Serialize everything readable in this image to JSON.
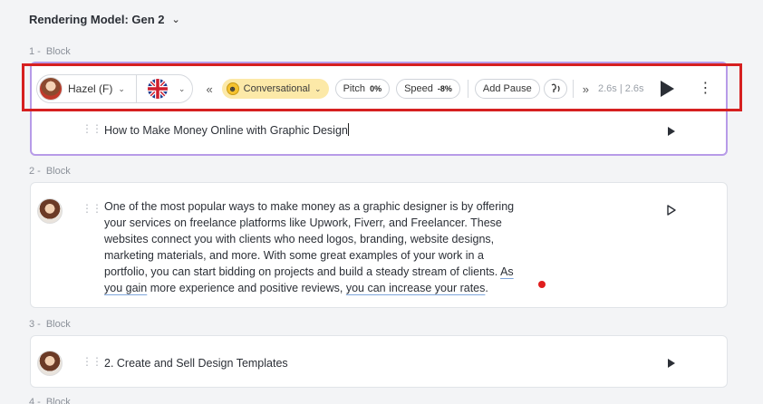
{
  "header": {
    "model_label": "Rendering Model: Gen 2"
  },
  "toolbar": {
    "voice_name": "Hazel (F)",
    "style_label": "Conversational",
    "pitch_label": "Pitch",
    "pitch_value": "0%",
    "speed_label": "Speed",
    "speed_value": "-8%",
    "add_pause_label": "Add Pause",
    "timing": "2.6s | 2.6s"
  },
  "blocks": [
    {
      "num": "1 -",
      "label": "Block",
      "text": "How to Make Money Online with Graphic Design"
    },
    {
      "num": "2 -",
      "label": "Block",
      "lines": [
        "One of the most popular ways to make money as a graphic designer is by offering",
        "your services on freelance platforms like Upwork, Fiverr, and Freelancer. These",
        "websites connect you with clients who need logos, branding, website designs,",
        "marketing materials, and more. With some great examples of your work in a",
        "portfolio, you can start bidding on projects and build a steady stream of clients.",
        "As",
        "you gain",
        " more experience and positive reviews, ",
        "you can increase your rates",
        "."
      ]
    },
    {
      "num": "3 -",
      "label": "Block",
      "text": "2. Create and Sell Design Templates"
    },
    {
      "num": "4 -",
      "label": "Block"
    }
  ],
  "colors": {
    "accent_border": "#b79be8",
    "highlight_box": "#d62020",
    "style_pill": "#fce9a8"
  },
  "icons": [
    "chevron-down-icon",
    "avatar-hazel",
    "uk-flag-icon",
    "rewind-icon",
    "smiley-icon",
    "voice-effect-icon",
    "forward-icon",
    "play-icon",
    "more-vertical-icon",
    "drag-handle-icon"
  ]
}
